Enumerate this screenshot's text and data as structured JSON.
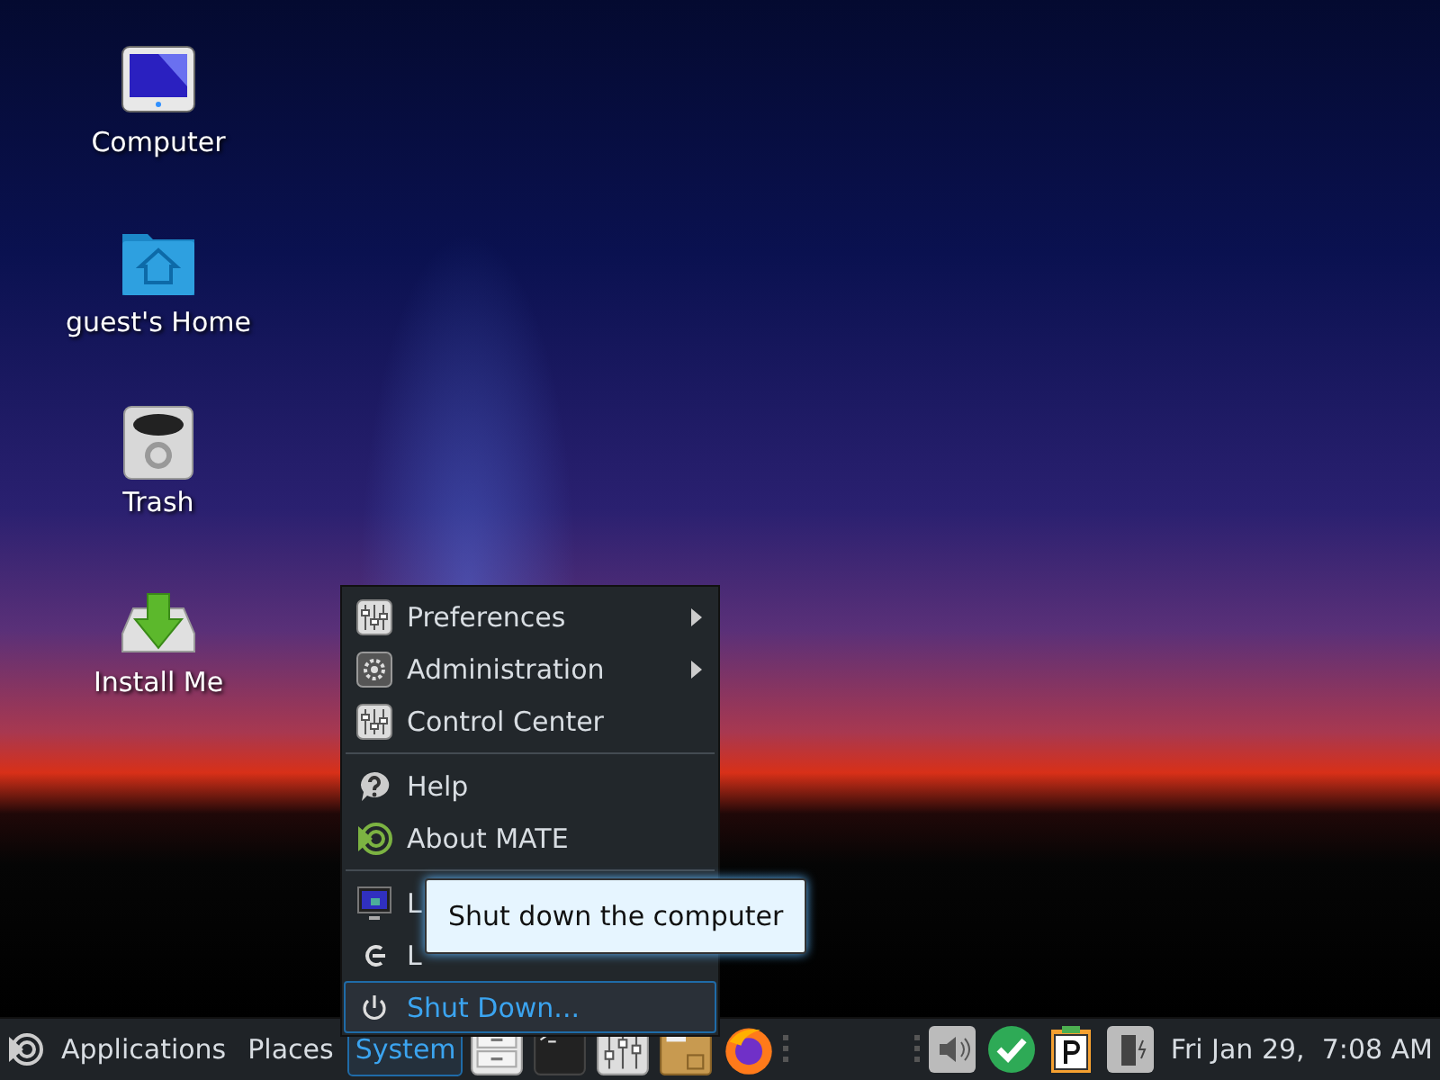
{
  "desktop_icons": [
    {
      "kind": "computer",
      "label": "Computer"
    },
    {
      "kind": "home",
      "label": "guest's Home"
    },
    {
      "kind": "trash",
      "label": "Trash"
    },
    {
      "kind": "install",
      "label": "Install Me"
    }
  ],
  "system_menu": {
    "groups": [
      [
        {
          "kind": "sliders",
          "label": "Preferences",
          "submenu": true,
          "selected": false
        },
        {
          "kind": "admin",
          "label": "Administration",
          "submenu": true,
          "selected": false
        },
        {
          "kind": "sliders",
          "label": "Control Center",
          "submenu": false,
          "selected": false
        }
      ],
      [
        {
          "kind": "help",
          "label": "Help",
          "submenu": false,
          "selected": false
        },
        {
          "kind": "mate",
          "label": "About MATE",
          "submenu": false,
          "selected": false
        }
      ],
      [
        {
          "kind": "lock",
          "label": "L",
          "submenu": false,
          "selected": false
        },
        {
          "kind": "logout",
          "label": "L",
          "submenu": false,
          "selected": false
        },
        {
          "kind": "power",
          "label": "Shut Down...",
          "submenu": false,
          "selected": true
        }
      ]
    ]
  },
  "tooltip": "Shut down the computer",
  "panel": {
    "menus": [
      {
        "label": "Applications",
        "selected": false
      },
      {
        "label": "Places",
        "selected": false
      },
      {
        "label": "System",
        "selected": true
      }
    ],
    "launchers": [
      {
        "kind": "files"
      },
      {
        "kind": "terminal"
      },
      {
        "kind": "mixer"
      },
      {
        "kind": "package"
      },
      {
        "kind": "browser"
      }
    ],
    "tray": [
      {
        "kind": "volume"
      },
      {
        "kind": "updates"
      },
      {
        "kind": "clipboard"
      },
      {
        "kind": "battery"
      }
    ],
    "clock": "Fri Jan 29,  7:08 AM"
  }
}
